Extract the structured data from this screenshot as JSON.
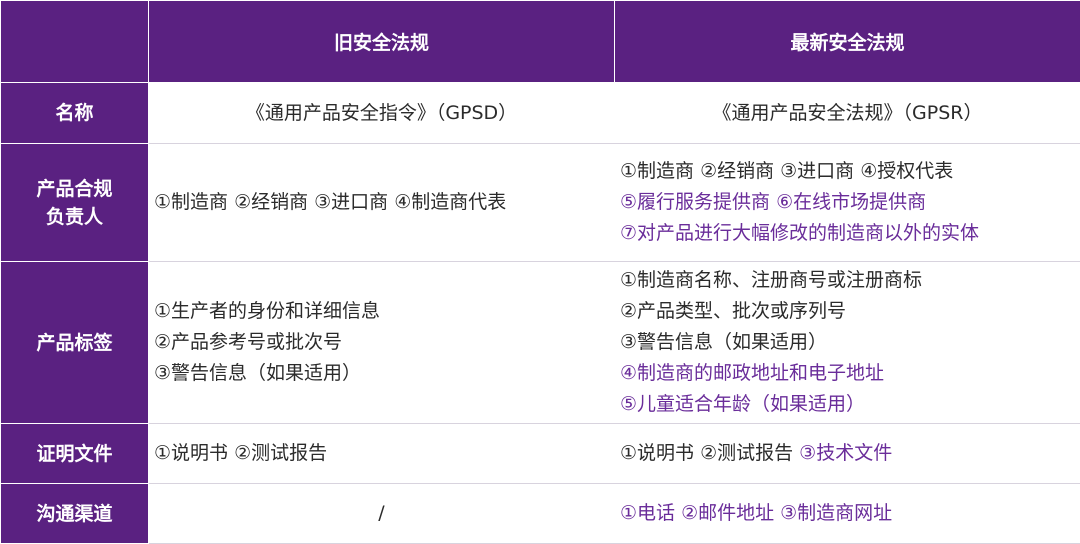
{
  "header": {
    "corner": "",
    "old_title": "旧安全法规",
    "new_title": "最新安全法规"
  },
  "rows": {
    "name": {
      "label": "名称",
      "old": "《通用产品安全指令》（GPSD）",
      "new": "《通用产品安全法规》（GPSR）"
    },
    "responsible": {
      "label_line1": "产品合规",
      "label_line2": "负责人",
      "old": "①制造商 ②经销商 ③进口商 ④制造商代表",
      "new_line1": "①制造商 ②经销商 ③进口商 ④授权代表",
      "new_line2": "⑤履行服务提供商 ⑥在线市场提供商",
      "new_line3": "⑦对产品进行大幅修改的制造商以外的实体"
    },
    "label_row": {
      "label": "产品标签",
      "old_line1": "①生产者的身份和详细信息",
      "old_line2": "②产品参考号或批次号",
      "old_line3": "③警告信息（如果适用）",
      "new_line1": "①制造商名称、注册商号或注册商标",
      "new_line2": "②产品类型、批次或序列号",
      "new_line3": "③警告信息（如果适用）",
      "new_line4": "④制造商的邮政地址和电子地址",
      "new_line5": "⑤儿童适合年龄（如果适用）"
    },
    "docs": {
      "label": "证明文件",
      "old": "①说明书 ②测试报告",
      "new_normal": "①说明书 ②测试报告 ",
      "new_highlight": "③技术文件"
    },
    "channels": {
      "label": "沟通渠道",
      "old": "/",
      "new": "①电话 ②邮件地址 ③制造商网址"
    }
  },
  "colors": {
    "header_bg": "#5a2181",
    "highlight_text": "#6a2d9a",
    "normal_text": "#2b2b2b"
  }
}
